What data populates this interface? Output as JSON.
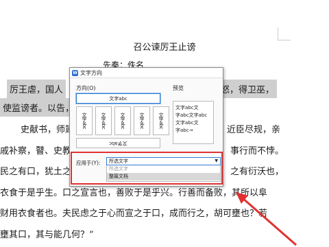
{
  "document": {
    "title": "召公谏厉王止谤",
    "author": "先秦：佚名",
    "lines": [
      {
        "text": "厉王虐，国人",
        "highlight": true
      },
      {
        "text": "怒，得卫巫，",
        "highlight": true
      },
      {
        "text": "使监谤者。以告，",
        "highlight": true
      },
      {
        "text": "史献书，师箴",
        "highlight": false
      },
      {
        "text": "近臣尽规，亲",
        "highlight": false
      },
      {
        "text": "戚补察，瞽、史教",
        "highlight": false
      },
      {
        "text": "事行而不悖。",
        "highlight": false
      },
      {
        "text": "民之有口，犹土之",
        "highlight": false
      },
      {
        "text": "之有衍沃也，",
        "highlight": false
      },
      {
        "text": "衣食于是乎生。口之宣言也，善败于是乎兴。行善而备败，其所以阜",
        "highlight": false
      },
      {
        "text": "财用衣食者也。夫民虑之于心而宣之于口，成而行之，胡可壅也？若",
        "highlight": false
      },
      {
        "text": "壅其口，其与能几何？”",
        "highlight": false
      }
    ]
  },
  "dialog": {
    "title": "文字方向",
    "app_icon": "W",
    "direction_label": "方向(O)",
    "preview_label": "预览",
    "options": {
      "horizontal": "文字abc",
      "vertical_1": "文字abc",
      "vertical_2": "文字abc",
      "vertical_3": "文字abc",
      "vertical_4": "文字abc",
      "vertical_5": "文字abc",
      "rotated": "文字abc"
    },
    "preview_lines": [
      "文字abc文",
      "字abc文字abc",
      "文字abc文",
      "字abc→"
    ],
    "apply_label": "应用于(Y):",
    "apply_value": "所选文字",
    "apply_options": [
      "所选文字",
      "整篇文档"
    ],
    "hovered_option": "整篇文档"
  },
  "colors": {
    "highlight": "#cfcfcf",
    "annotation_red": "#e23030",
    "accent_blue": "#2e7bcf"
  }
}
